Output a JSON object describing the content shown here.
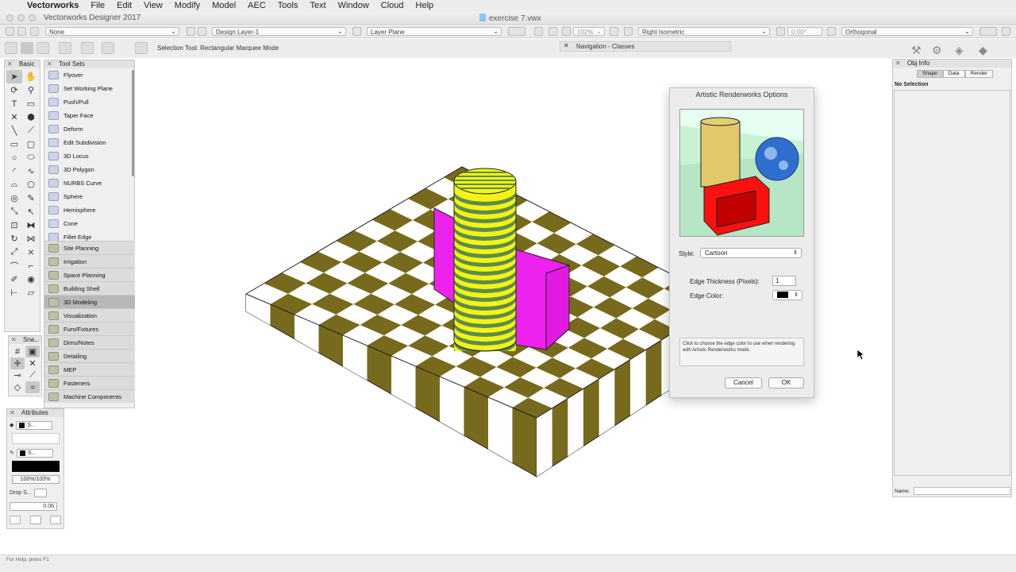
{
  "menu": {
    "apple_icon": "apple-icon",
    "items": [
      "Vectorworks",
      "File",
      "Edit",
      "View",
      "Modify",
      "Model",
      "AEC",
      "Tools",
      "Text",
      "Window",
      "Cloud",
      "Help"
    ]
  },
  "window": {
    "app_title": "Vectorworks Designer 2017",
    "document_title": "exercise 7.vwx"
  },
  "mode_bar": {
    "class_select": "None",
    "layer_select": "Design Layer-1",
    "plane_select": "Layer Plane",
    "zoom_value": "102%",
    "view_select": "Right Isometric",
    "rotation_value": "0.00°",
    "projection_select": "Orthogonal"
  },
  "tool_bar": {
    "status_text": "Selection Tool: Rectangular Marquee Mode",
    "navigation_palette_title": "Navigation - Classes"
  },
  "basic_palette": {
    "title": "Basic",
    "tools": [
      "arrow",
      "hand",
      "rotate",
      "zoom",
      "T",
      "rect-sel",
      "x",
      "fill",
      "line",
      "line2",
      "rect",
      "round-rect",
      "circle",
      "oval",
      "arc",
      "curve",
      "poly",
      "poly2",
      "spiral",
      "spiral2",
      "star",
      "stamp",
      "move",
      "loop",
      "align",
      "mirror",
      "sel",
      "arc2",
      "wall",
      "box",
      "eye",
      "plot",
      "scale",
      "window"
    ]
  },
  "snapping_palette": {
    "title": "Sna..."
  },
  "tool_sets_palette": {
    "title": "Tool Sets",
    "tools": [
      "Flyover",
      "Set Working Plane",
      "Push/Pull",
      "Taper Face",
      "Deform",
      "Edit Subdivision",
      "3D Locus",
      "3D Polygon",
      "NURBS Curve",
      "Sphere",
      "Hemisphere",
      "Cone",
      "Fillet Edge"
    ],
    "sets": [
      "Site Planning",
      "Irrigation",
      "Space Planning",
      "Building Shell",
      "3D Modeling",
      "Visualization",
      "Furn/Fixtures",
      "Dims/Notes",
      "Detailing",
      "MEP",
      "Fasteners",
      "Machine Components"
    ],
    "selected_set": "3D Modeling"
  },
  "attributes_palette": {
    "title": "Attributes",
    "fill_style": "S...",
    "pen_style": "S...",
    "opacity": "100%/100%",
    "drop_shadow": "Drop S...",
    "line_thickness": "0.06"
  },
  "dialog": {
    "title": "Artistic Renderworks Options",
    "style_label": "Style:",
    "style_value": "Cartoon",
    "edge_thickness_label": "Edge Thickness (Pixels):",
    "edge_thickness_value": "1",
    "edge_color_label": "Edge Color:",
    "edge_color": "#000000",
    "help_text": "Click to choose the edge color to use when rendering with Artistic Renderworks mode.",
    "cancel_label": "Cancel",
    "ok_label": "OK"
  },
  "obj_info": {
    "title": "Obj Info",
    "tabs": [
      "Shape",
      "Data",
      "Render"
    ],
    "selected_tab": "Shape",
    "selection_state": "No Selection",
    "name_label": "Name:",
    "name_value": ""
  },
  "status_bar": {
    "help_text": "For Help, press F1"
  },
  "colors": {
    "checker_dark": "#786a1c",
    "cylinder_yellow": "#f4f414",
    "cylinder_stripe": "#5c8c4c",
    "magenta": "#ee22ee",
    "accent": "#3a7bd5"
  }
}
